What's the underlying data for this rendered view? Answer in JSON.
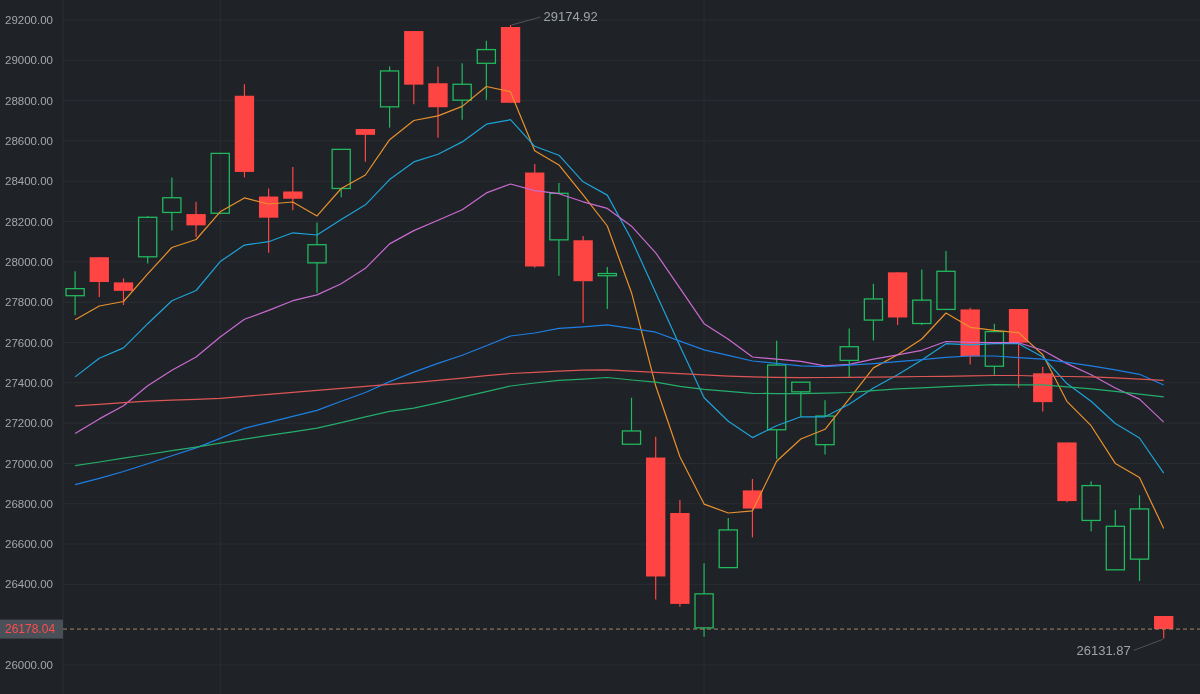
{
  "price_chart": {
    "chart_data": {
      "type": "candlestick",
      "grid": true,
      "ylim": [
        25856,
        29299
      ],
      "yticks": [
        {
          "value": 29200,
          "label": "29200.00"
        },
        {
          "value": 29000,
          "label": "29000.00"
        },
        {
          "value": 28800,
          "label": "28800.00"
        },
        {
          "value": 28600,
          "label": "28600.00"
        },
        {
          "value": 28400,
          "label": "28400.00"
        },
        {
          "value": 28200,
          "label": "28200.00"
        },
        {
          "value": 28000,
          "label": "28000.00"
        },
        {
          "value": 27800,
          "label": "27800.00"
        },
        {
          "value": 27600,
          "label": "27600.00"
        },
        {
          "value": 27400,
          "label": "27400.00"
        },
        {
          "value": 27200,
          "label": "27200.00"
        },
        {
          "value": 27000,
          "label": "27000.00"
        },
        {
          "value": 26800,
          "label": "26800.00"
        },
        {
          "value": 26600,
          "label": "26600.00"
        },
        {
          "value": 26400,
          "label": "26400.00"
        },
        {
          "value": 26000,
          "label": "26000.00"
        }
      ],
      "ohlc": [
        [
          27832,
          27953,
          27735,
          27867
        ],
        [
          28023,
          28023,
          27826,
          27900
        ],
        [
          27898,
          27918,
          27786,
          27856
        ],
        [
          28025,
          28228,
          27992,
          28221
        ],
        [
          28245,
          28419,
          28155,
          28318
        ],
        [
          28237,
          28298,
          28123,
          28181
        ],
        [
          28241,
          28540,
          28240,
          28538
        ],
        [
          28824,
          28881,
          28419,
          28446
        ],
        [
          28324,
          28364,
          28045,
          28219
        ],
        [
          28349,
          28470,
          28256,
          28313
        ],
        [
          27995,
          28195,
          27847,
          28085
        ],
        [
          28364,
          28560,
          28320,
          28558
        ],
        [
          28659,
          28659,
          28496,
          28630
        ],
        [
          28769,
          28969,
          28666,
          28947
        ],
        [
          29145,
          29145,
          28782,
          28879
        ],
        [
          28886,
          28969,
          28615,
          28767
        ],
        [
          28802,
          28985,
          28705,
          28881
        ],
        [
          28985,
          29097,
          28804,
          29053
        ],
        [
          29165,
          29174.92,
          28789,
          28789
        ],
        [
          28443,
          28486,
          27971,
          27977
        ],
        [
          28109,
          28391,
          27931,
          28340
        ],
        [
          28107,
          28128,
          27698,
          27904
        ],
        [
          27931,
          27975,
          27766,
          27942
        ],
        [
          27095,
          27326,
          27095,
          27161
        ],
        [
          27029,
          27132,
          26325,
          26439
        ],
        [
          26754,
          26818,
          26289,
          26303
        ],
        [
          26184,
          26505,
          26140,
          26353
        ],
        [
          26483,
          26729,
          26483,
          26670
        ],
        [
          26866,
          26923,
          26633,
          26776
        ],
        [
          27167,
          27609,
          27022,
          27488
        ],
        [
          27355,
          27403,
          27230,
          27403
        ],
        [
          27093,
          27313,
          27044,
          27235
        ],
        [
          27511,
          27669,
          27429,
          27579
        ],
        [
          27711,
          27891,
          27610,
          27816
        ],
        [
          27948,
          27948,
          27687,
          27724
        ],
        [
          27694,
          27962,
          27687,
          27810
        ],
        [
          27764,
          28054,
          27764,
          27953
        ],
        [
          27764,
          27772,
          27491,
          27531
        ],
        [
          27482,
          27693,
          27440,
          27654
        ],
        [
          27766,
          27766,
          27376,
          27599
        ],
        [
          27447,
          27480,
          27258,
          27304
        ],
        [
          27104,
          27104,
          26807,
          26813
        ],
        [
          26717,
          26912,
          26663,
          26890
        ],
        [
          26472,
          26769,
          26472,
          26688
        ],
        [
          26525,
          26842,
          26417,
          26774
        ],
        [
          26243,
          26243,
          26131.87,
          26178.04
        ],
        null
      ],
      "series": [
        {
          "type": "line",
          "color": "#e8912d",
          "values": [
            27713,
            27781,
            27803,
            27940,
            28071,
            28111,
            28248,
            28317,
            28287,
            28297,
            28228,
            28364,
            28431,
            28606,
            28701,
            28724,
            28771,
            28870,
            28844,
            28551,
            28481,
            28332,
            28178,
            27847,
            27385,
            27033,
            26798,
            26754,
            26765,
            27011,
            27121,
            27169,
            27320,
            27474,
            27539,
            27617,
            27746,
            27675,
            27660,
            27649,
            27539,
            27308,
            27187,
            27000,
            26930,
            26677,
            null
          ]
        },
        {
          "type": "line",
          "color": "#1ea3d8",
          "values": [
            27429,
            27522,
            27573,
            27693,
            27807,
            27858,
            28001,
            28083,
            28100,
            28144,
            28133,
            28210,
            28283,
            28408,
            28496,
            28534,
            28595,
            28683,
            28705,
            28573,
            28529,
            28397,
            28331,
            28111,
            27847,
            27583,
            27326,
            27209,
            27128,
            27187,
            27231,
            27231,
            27293,
            27374,
            27440,
            27513,
            27594,
            27588,
            27594,
            27594,
            27528,
            27396,
            27308,
            27198,
            27126,
            26952,
            null
          ]
        },
        {
          "type": "line",
          "color": "#c96bd1",
          "values": [
            27148,
            27221,
            27286,
            27385,
            27462,
            27528,
            27627,
            27715,
            27759,
            27807,
            27836,
            27891,
            27968,
            28089,
            28155,
            28206,
            28258,
            28342,
            28386,
            28353,
            28338,
            28298,
            28265,
            28177,
            28045,
            27869,
            27693,
            27616,
            27528,
            27517,
            27506,
            27484,
            27491,
            27517,
            27539,
            27561,
            27605,
            27601,
            27599,
            27599,
            27561,
            27495,
            27440,
            27374,
            27319,
            27205,
            null
          ]
        },
        {
          "type": "line",
          "color": "#1e7fe3",
          "values": [
            26895,
            26926,
            26960,
            26998,
            27038,
            27077,
            27124,
            27174,
            27204,
            27233,
            27263,
            27308,
            27352,
            27406,
            27453,
            27496,
            27537,
            27584,
            27632,
            27647,
            27670,
            27677,
            27687,
            27670,
            27651,
            27607,
            27563,
            27536,
            27508,
            27496,
            27484,
            27480,
            27487,
            27495,
            27505,
            27515,
            27526,
            27533,
            27533,
            27525,
            27517,
            27501,
            27484,
            27464,
            27442,
            27389,
            null
          ]
        },
        {
          "type": "line",
          "color": "#dc5656",
          "values": [
            27286,
            27293,
            27301,
            27309,
            27314,
            27318,
            27323,
            27333,
            27343,
            27353,
            27362,
            27372,
            27382,
            27392,
            27401,
            27412,
            27423,
            27435,
            27446,
            27452,
            27458,
            27463,
            27464,
            27458,
            27452,
            27445,
            27439,
            27433,
            27429,
            27427,
            27425,
            27426,
            27427,
            27428,
            27429,
            27431,
            27432,
            27434,
            27436,
            27436,
            27433,
            27431,
            27429,
            27424,
            27418,
            27412,
            null
          ]
        },
        {
          "type": "line",
          "color": "#25ad6c",
          "values": [
            26989,
            27007,
            27026,
            27044,
            27063,
            27081,
            27100,
            27120,
            27139,
            27157,
            27175,
            27202,
            27231,
            27258,
            27274,
            27300,
            27329,
            27356,
            27384,
            27399,
            27412,
            27418,
            27426,
            27414,
            27403,
            27382,
            27367,
            27357,
            27348,
            27346,
            27346,
            27349,
            27352,
            27361,
            27370,
            27375,
            27381,
            27386,
            27391,
            27390,
            27390,
            27380,
            27370,
            27357,
            27344,
            27330,
            null
          ]
        }
      ],
      "annotations": [
        "29174.92",
        "26131.87"
      ],
      "ref_lines": [
        {
          "axis": "y",
          "value": 26178.04,
          "label": "26178.04"
        }
      ]
    }
  }
}
